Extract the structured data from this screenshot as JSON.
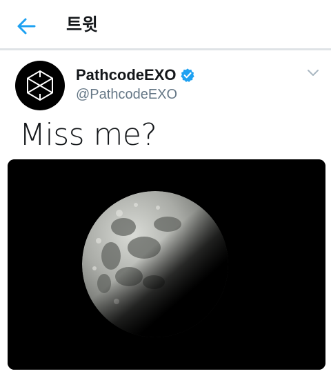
{
  "header": {
    "title": "트윗",
    "back_icon": "arrow-left-icon",
    "accent_color": "#1da1f2"
  },
  "tweet": {
    "author": {
      "display_name": "PathcodeEXO",
      "handle": "@PathcodeEXO",
      "verified": true,
      "avatar_icon": "exo-hexagon-logo"
    },
    "text": "Miss me?",
    "media": {
      "kind": "photo",
      "subject": "moon"
    },
    "menu_icon": "chevron-down-icon"
  }
}
